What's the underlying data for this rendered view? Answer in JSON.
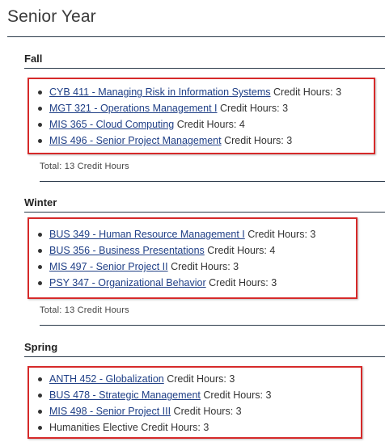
{
  "page_title": "Senior Year",
  "terms": [
    {
      "name": "Fall",
      "courses": [
        {
          "link": "CYB 411 - Managing Risk in Information Systems",
          "hours": "Credit Hours: 3"
        },
        {
          "link": "MGT 321 - Operations Management I",
          "hours": "Credit Hours: 3"
        },
        {
          "link": "MIS 365 - Cloud Computing",
          "hours": "Credit Hours: 4"
        },
        {
          "link": "MIS 496 - Senior Project Management",
          "hours": "Credit Hours: 3"
        }
      ],
      "total": "Total: 13 Credit Hours"
    },
    {
      "name": "Winter",
      "courses": [
        {
          "link": "BUS 349 - Human Resource Management I",
          "hours": "Credit Hours: 3"
        },
        {
          "link": "BUS 356 - Business Presentations",
          "hours": "Credit Hours: 4"
        },
        {
          "link": "MIS 497 - Senior Project II",
          "hours": "Credit Hours: 3"
        },
        {
          "link": "PSY 347 - Organizational Behavior",
          "hours": "Credit Hours: 3"
        }
      ],
      "total": "Total: 13 Credit Hours"
    },
    {
      "name": "Spring",
      "courses": [
        {
          "link": "ANTH 452 - Globalization",
          "hours": "Credit Hours: 3"
        },
        {
          "link": "BUS 478 - Strategic Management",
          "hours": "Credit Hours: 3"
        },
        {
          "link": "MIS 498 - Senior Project III",
          "hours": "Credit Hours: 3"
        },
        {
          "text": "Humanities Elective",
          "hours": "Credit Hours: 3"
        }
      ]
    }
  ],
  "colors": {
    "link": "#1f3f86",
    "highlight_box": "#d62a2a",
    "rule": "#2b3a4a"
  }
}
